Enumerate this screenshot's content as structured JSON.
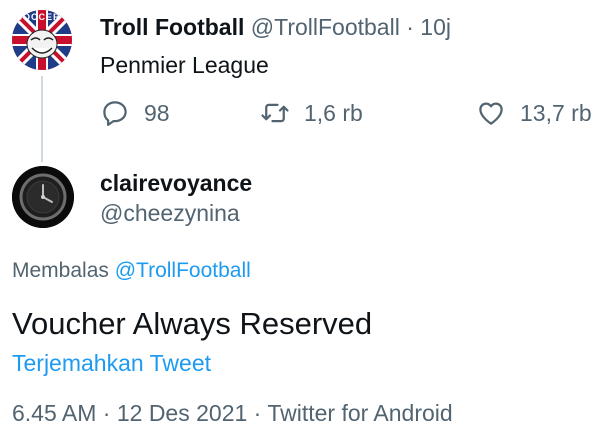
{
  "parent_tweet": {
    "display_name": "Troll Football",
    "handle": "@TrollFootball",
    "separator": "·",
    "time": "10j",
    "text": "Penmier League",
    "avatar_text": "SOCCER",
    "avatar_icon": "troll-face-union-jack",
    "actions": {
      "reply_count": "98",
      "retweet_count": "1,6 rb",
      "like_count": "13,7 rb"
    }
  },
  "reply_tweet": {
    "display_name": "clairevoyance",
    "handle": "@cheezynina",
    "replying_prefix": "Membalas",
    "replying_to": "@TrollFootball",
    "text": "Voucher Always Reserved",
    "translate_label": "Terjemahkan Tweet",
    "time": "6.45 AM",
    "date": "12 Des 2021",
    "source": "Twitter for Android",
    "separator": "·",
    "avatar_icon": "dark-watch-dial"
  },
  "colors": {
    "text_primary": "#0f1419",
    "text_secondary": "#536471",
    "link": "#1d9bf0",
    "thread_line": "#cfd9de"
  }
}
